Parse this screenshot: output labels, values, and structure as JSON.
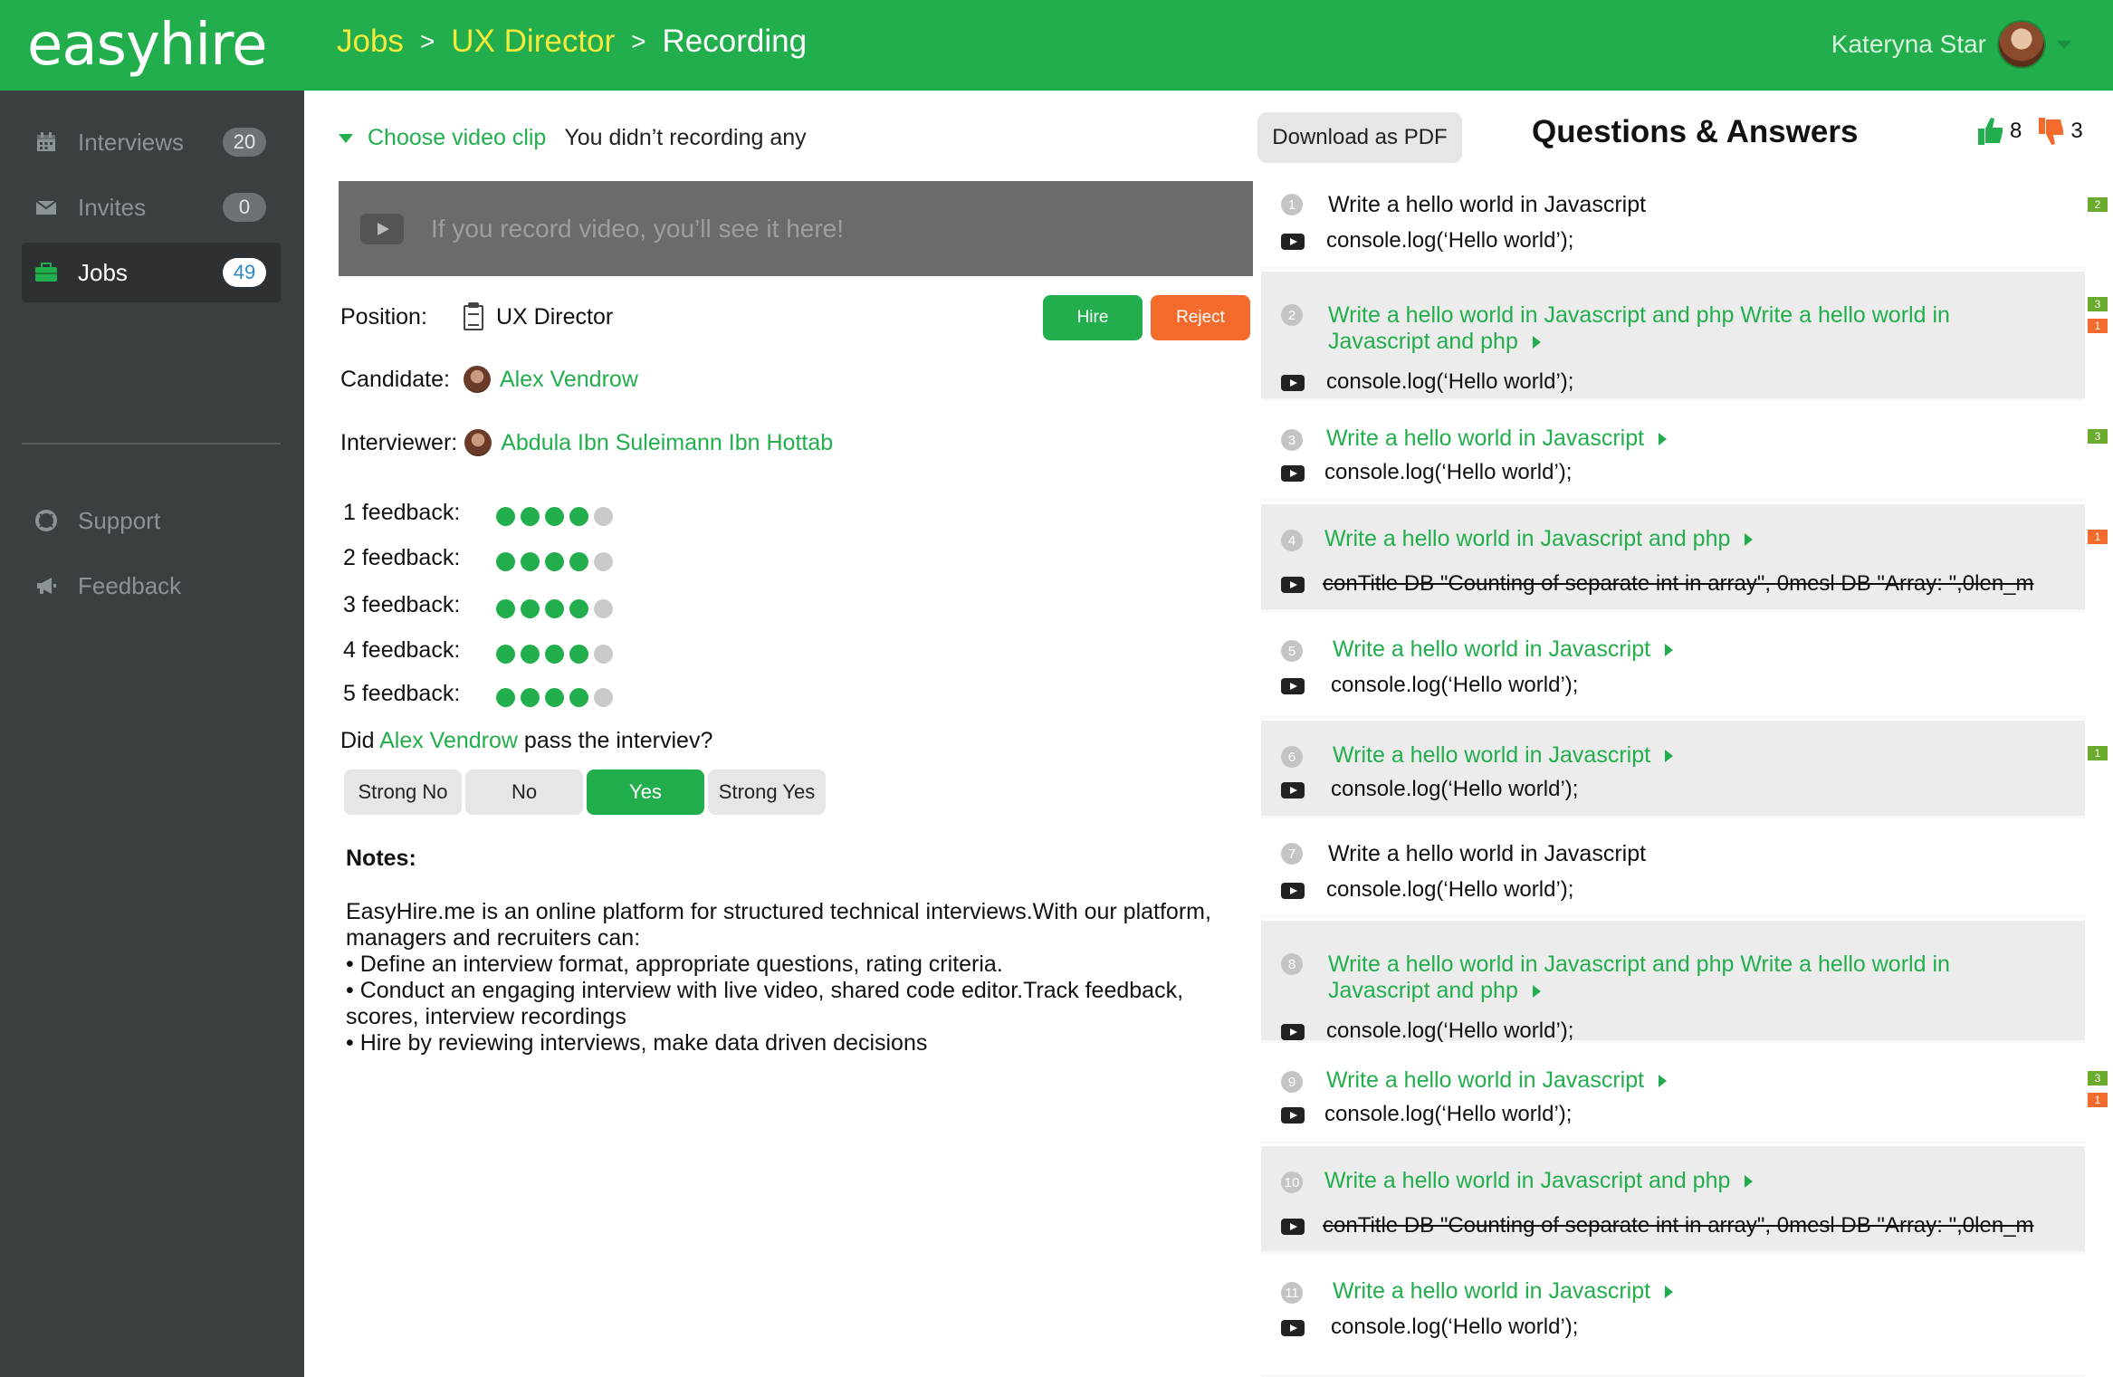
{
  "header": {
    "logo": "easyhire",
    "breadcrumbs": [
      "Jobs",
      "UX Director",
      "Recording"
    ],
    "separator": ">",
    "user_name": "Kateryna Star"
  },
  "sidebar": {
    "items": [
      {
        "label": "Interviews",
        "badge": "20",
        "icon": "calendar-icon"
      },
      {
        "label": "Invites",
        "badge": "0",
        "icon": "envelope-icon"
      },
      {
        "label": "Jobs",
        "badge": "49",
        "icon": "briefcase-icon",
        "active": true
      },
      {
        "label": "Support",
        "icon": "lifebuoy-icon"
      },
      {
        "label": "Feedback",
        "icon": "megaphone-icon"
      }
    ]
  },
  "video": {
    "chooser_label": "Choose video clip",
    "status": "You didn’t recording any",
    "placeholder": "If you record video, you’ll see it here!"
  },
  "details": {
    "position_label": "Position:",
    "position_value": "UX Director",
    "candidate_label": "Candidate:",
    "candidate_value": "Alex Vendrow",
    "interviewer_label": "Interviewer:",
    "interviewer_value": "Abdula Ibn Suleimann Ibn Hottab"
  },
  "actions": {
    "hire": "Hire",
    "reject": "Reject"
  },
  "feedback": [
    {
      "label": "1 feedback:",
      "rating": 4,
      "max": 5
    },
    {
      "label": "2 feedback:",
      "rating": 4,
      "max": 5
    },
    {
      "label": "3 feedback:",
      "rating": 4,
      "max": 5
    },
    {
      "label": "4 feedback:",
      "rating": 4,
      "max": 5
    },
    {
      "label": "5 feedback:",
      "rating": 4,
      "max": 5
    }
  ],
  "pass": {
    "prefix": "Did ",
    "name": "Alex Vendrow",
    "suffix": " pass the interviev?",
    "options": [
      "Strong No",
      "No",
      "Yes",
      "Strong Yes"
    ],
    "selected": "Yes"
  },
  "notes": {
    "title": "Notes:",
    "body": "EasyHire.me is an online platform for structured technical interviews.With our platform, managers and recruiters can:",
    "bullets": [
      "• Define an interview format, appropriate questions, rating criteria.",
      "• Conduct an engaging interview with live video, shared code editor.Track feedback, scores, interview recordings",
      "• Hire by reviewing interviews, make data driven decisions"
    ]
  },
  "qa": {
    "download": "Download as PDF",
    "title": "Questions & Answers",
    "thumbs_up": "8",
    "thumbs_down": "3",
    "questions": [
      {
        "num": "1",
        "text": "Write a hello world in Javascript",
        "link": false,
        "answer": "console.log(‘Hello world’);",
        "strike": false,
        "up": "2",
        "down": ""
      },
      {
        "num": "2",
        "text": "Write a hello world in Javascript and php Write a hello world in Javascript and php",
        "link": true,
        "answer": "console.log(‘Hello world’);",
        "strike": false,
        "up": "3",
        "down": "1"
      },
      {
        "num": "3",
        "text": "Write a hello world in Javascript",
        "link": true,
        "answer": "console.log(‘Hello world’);",
        "strike": false,
        "up": "3",
        "down": ""
      },
      {
        "num": "4",
        "text": "Write a hello world in Javascript and php",
        "link": true,
        "answer": "conTitle DB \"Counting of separate int in array\", 0mesl DB \"Array: \",0len_m",
        "strike": true,
        "up": "",
        "down": "1"
      },
      {
        "num": "5",
        "text": "Write a hello world in Javascript",
        "link": true,
        "answer": "console.log(‘Hello world’);",
        "strike": false,
        "up": "",
        "down": ""
      },
      {
        "num": "6",
        "text": "Write a hello world in Javascript",
        "link": true,
        "answer": "console.log(‘Hello world’);",
        "strike": false,
        "up": "1",
        "down": ""
      },
      {
        "num": "7",
        "text": "Write a hello world in Javascript",
        "link": false,
        "answer": "console.log(‘Hello world’);",
        "strike": false,
        "up": "",
        "down": ""
      },
      {
        "num": "8",
        "text": "Write a hello world in Javascript and php Write a hello world in Javascript and php",
        "link": true,
        "answer": "console.log(‘Hello world’);",
        "strike": false,
        "up": "",
        "down": ""
      },
      {
        "num": "9",
        "text": "Write a hello world in Javascript",
        "link": true,
        "answer": "console.log(‘Hello world’);",
        "strike": false,
        "up": "3",
        "down": "1"
      },
      {
        "num": "10",
        "text": "Write a hello world in Javascript and php",
        "link": true,
        "answer": "conTitle DB \"Counting of separate int in array\", 0mesl DB \"Array: \",0len_m",
        "strike": true,
        "up": "",
        "down": ""
      },
      {
        "num": "11",
        "text": "Write a hello world in Javascript",
        "link": true,
        "answer": "console.log(‘Hello world’);",
        "strike": false,
        "up": "",
        "down": ""
      }
    ]
  },
  "colors": {
    "brand": "#22ae4c",
    "accent_orange": "#f36b2c",
    "sidebar": "#3a3f41"
  }
}
